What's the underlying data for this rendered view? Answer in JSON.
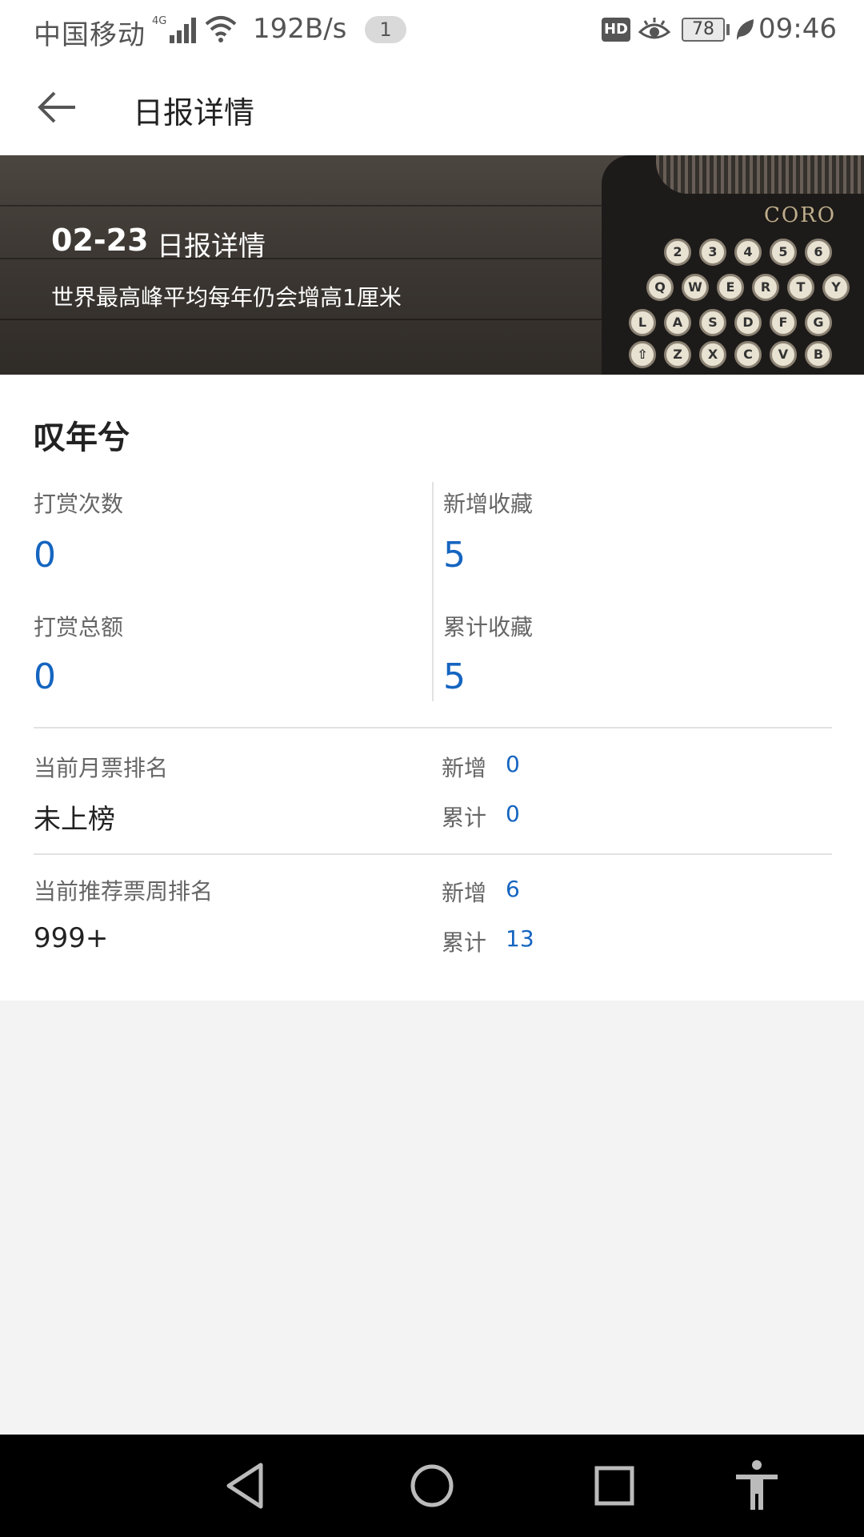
{
  "status_bar": {
    "carrier": "中国移动",
    "network": "4G",
    "speed": "192B/s",
    "notification_count": "1",
    "hd": "HD",
    "battery": "78",
    "time": "09:46"
  },
  "toolbar": {
    "back_icon": "arrow-left-icon",
    "title": "日报详情"
  },
  "banner": {
    "date": "02-23",
    "title": "日报详情",
    "subtitle": "世界最高峰平均每年仍会增高1厘米",
    "brand_text": "CORO"
  },
  "author": "叹年兮",
  "stats": {
    "tip_count": {
      "label": "打赏次数",
      "value": "0"
    },
    "new_favorites": {
      "label": "新增收藏",
      "value": "5"
    },
    "tip_total": {
      "label": "打赏总额",
      "value": "0"
    },
    "total_favorites": {
      "label": "累计收藏",
      "value": "5"
    }
  },
  "monthly_ticket": {
    "label": "当前月票排名",
    "rank": "未上榜",
    "new_label": "新增",
    "new_value": "0",
    "total_label": "累计",
    "total_value": "0"
  },
  "recommend_ticket": {
    "label": "当前推荐票周排名",
    "rank": "999+",
    "new_label": "新增",
    "new_value": "6",
    "total_label": "累计",
    "total_value": "13"
  },
  "nav_bar": {
    "back": "triangle-back-icon",
    "home": "circle-home-icon",
    "recents": "square-recents-icon",
    "accessibility": "accessibility-icon"
  },
  "colors": {
    "accent_blue": "#1565c0",
    "background": "#f3f3f3"
  }
}
